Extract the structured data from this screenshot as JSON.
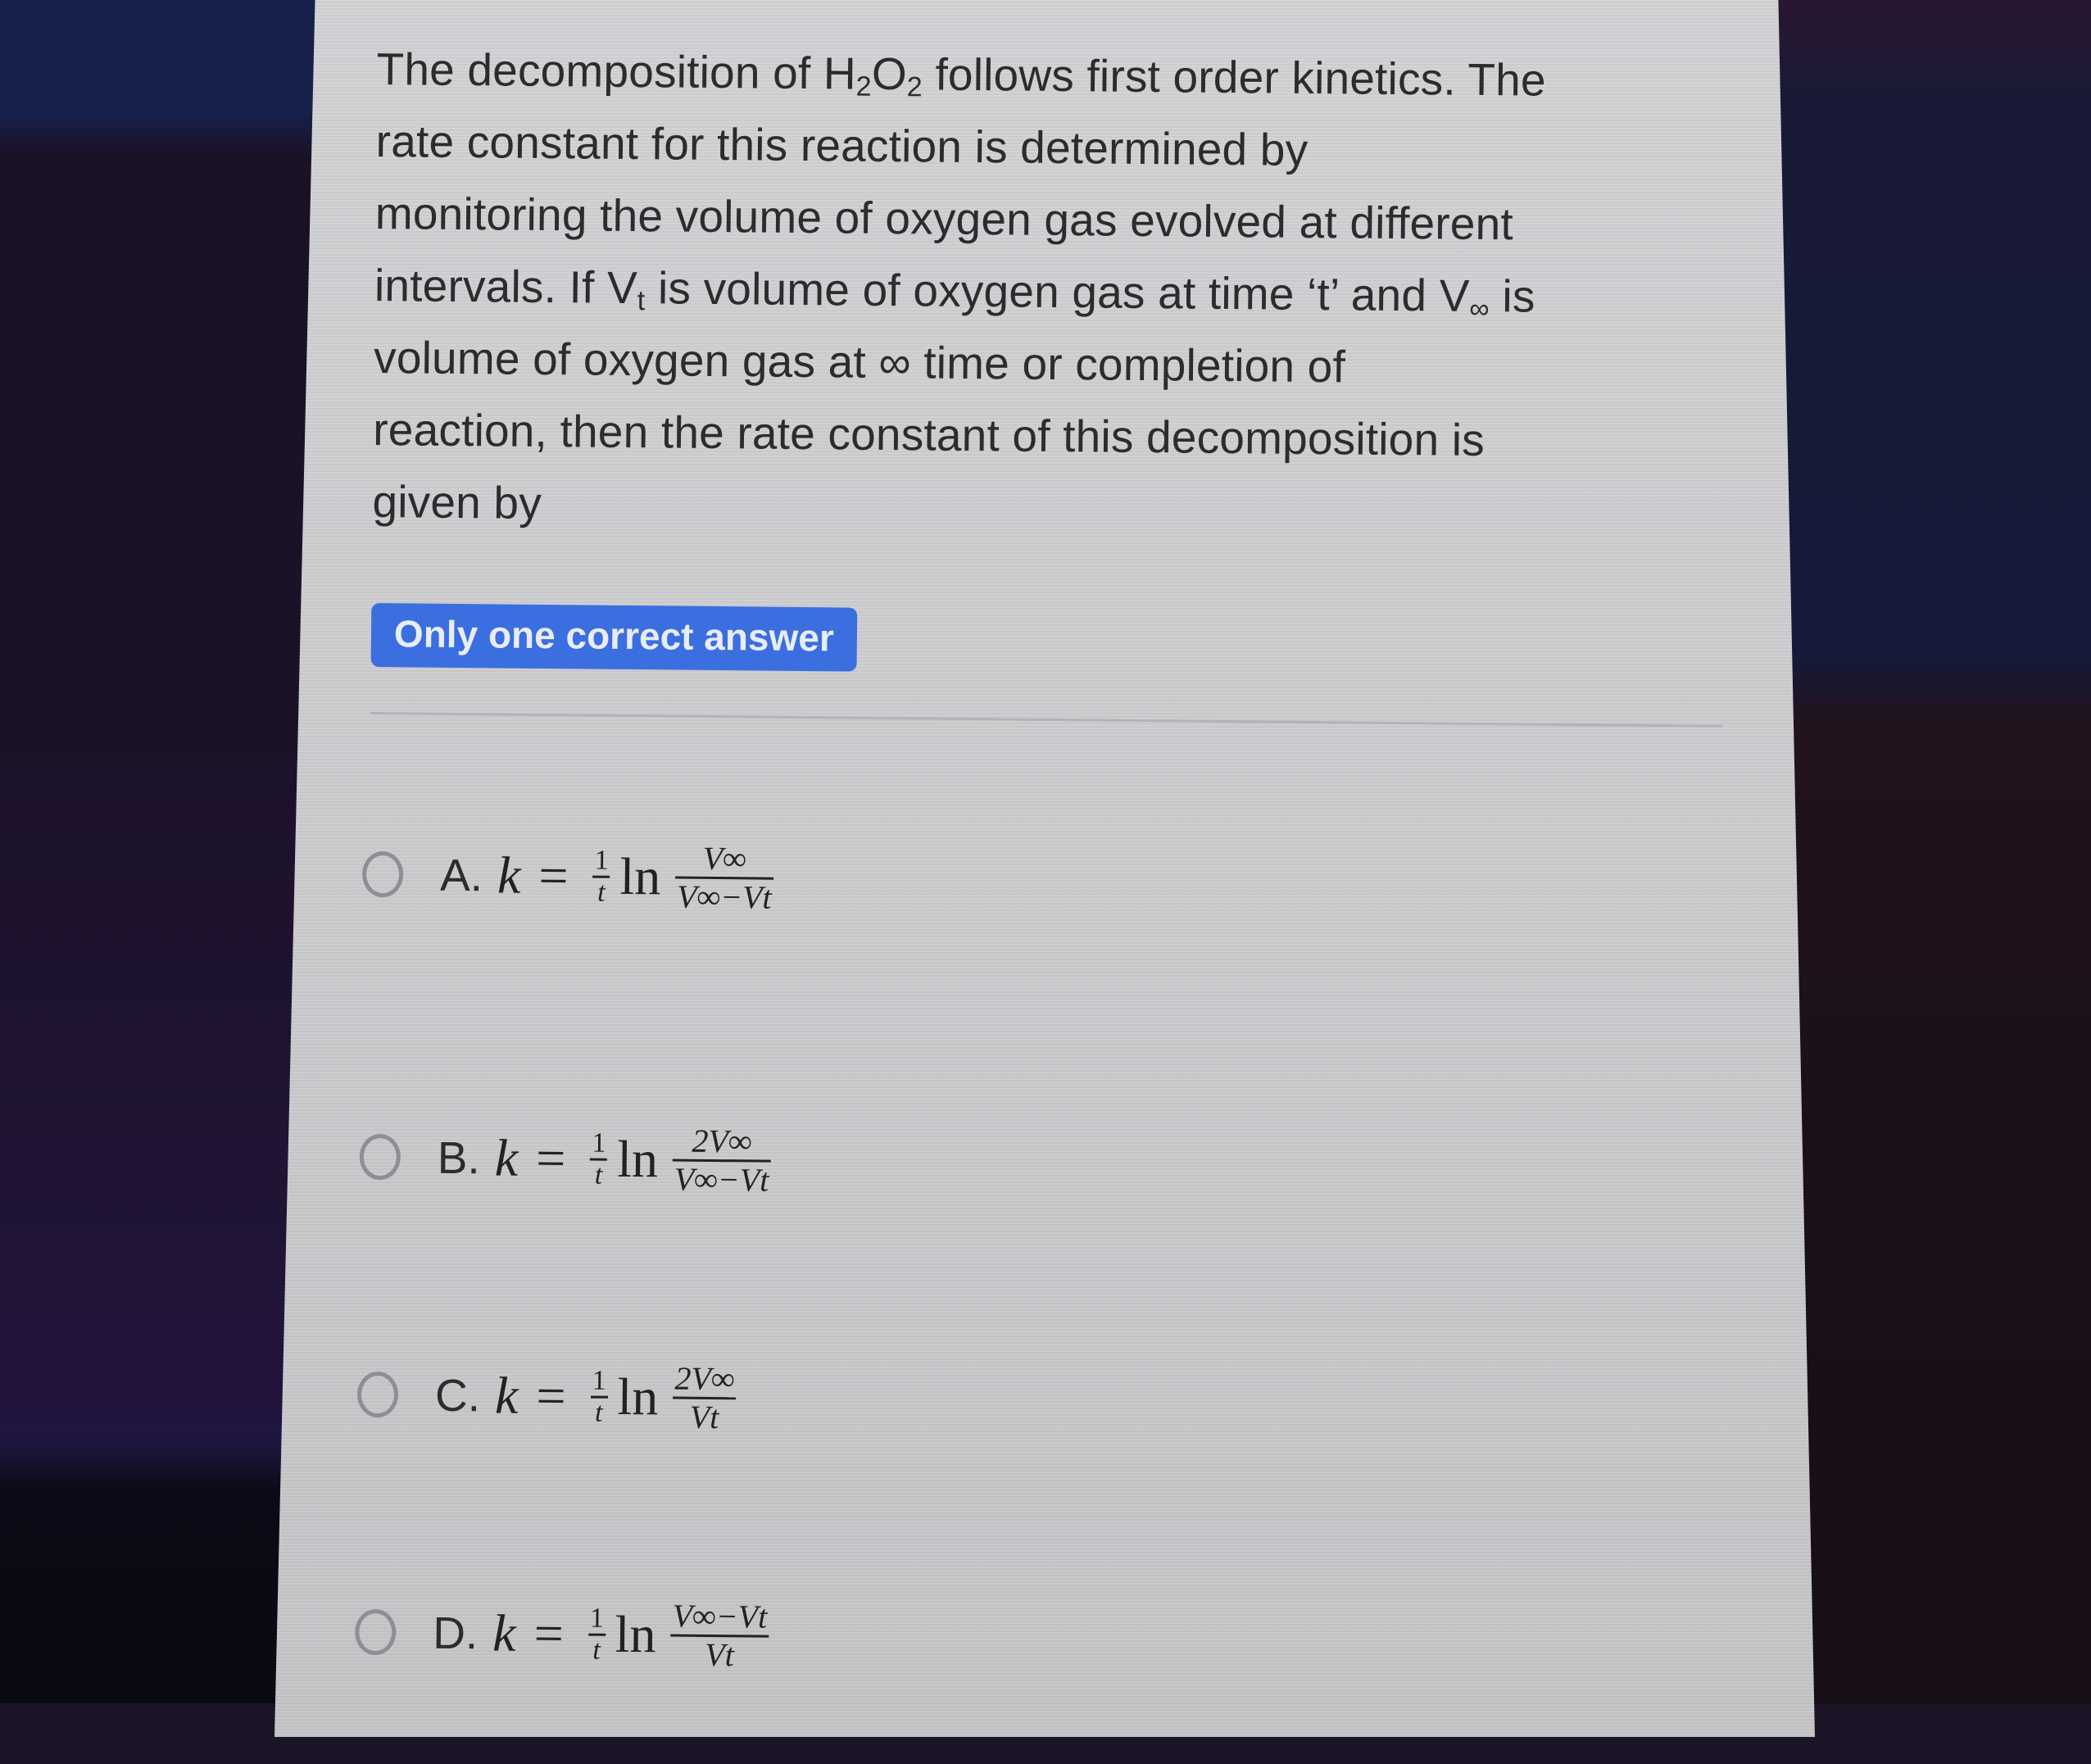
{
  "question": {
    "text_lines": [
      [
        "The decomposition of H",
        "2",
        "O",
        "2",
        " follows first order kinetics. The"
      ],
      "rate constant for this reaction is determined by",
      "monitoring the volume of oxygen gas evolved at different",
      [
        "intervals. If V",
        "t",
        " is volume of oxygen gas at time ‘t’ and V",
        "∞",
        " is"
      ],
      "volume of oxygen gas at ∞ time or completion of",
      "reaction, then the rate constant of this decomposition is",
      "given by"
    ]
  },
  "badge": {
    "label": "Only one correct answer",
    "color": "#3b6fe0"
  },
  "options": [
    {
      "letter": "A.",
      "lhs": "k",
      "eq": "=",
      "coef_num": "1",
      "coef_den": "t",
      "fn": "ln",
      "num": "V∞",
      "den": "V∞−Vt",
      "selected": false
    },
    {
      "letter": "B.",
      "lhs": "k",
      "eq": "=",
      "coef_num": "1",
      "coef_den": "t",
      "fn": "ln",
      "num": "2V∞",
      "den": "V∞−Vt",
      "selected": false
    },
    {
      "letter": "C.",
      "lhs": "k",
      "eq": "=",
      "coef_num": "1",
      "coef_den": "t",
      "fn": "ln",
      "num": "2V∞",
      "den": "Vt",
      "selected": false
    },
    {
      "letter": "D.",
      "lhs": "k",
      "eq": "=",
      "coef_num": "1",
      "coef_den": "t",
      "fn": "ln",
      "num": "V∞−Vt",
      "den": "Vt",
      "selected": false
    }
  ],
  "icons": {
    "radio": "radio-unchecked-icon"
  }
}
